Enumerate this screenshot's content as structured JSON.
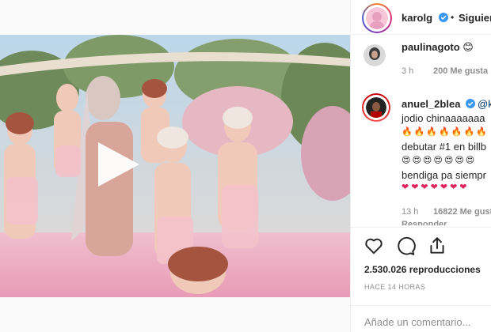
{
  "post": {
    "author": "karolg",
    "separator": "•",
    "follow_label": "Siguien"
  },
  "comments": [
    {
      "username": "paulinagoto",
      "lines": [
        "paulinagoto 😊"
      ],
      "time": "3 h",
      "likes": "200 Me gusta"
    },
    {
      "username": "anuel_2blea",
      "first_line_suffix": "@k",
      "lines": [
        "jodio chinaaaaaaa",
        "🔥🔥🔥🔥🔥🔥🔥",
        "debutar #1 en billb",
        "😍😍😍😍😍😍😍",
        "bendiga pa siempr"
      ],
      "hearts": "❤❤❤❤❤❤❤",
      "time": "13 h",
      "likes": "16822 Me gust",
      "reply_label": "Responder"
    }
  ],
  "stats": {
    "views": "2.530.026 reproducciones",
    "posted": "HACE 14 HORAS"
  },
  "add_comment": {
    "placeholder": "Añade un comentario..."
  },
  "icons": {
    "like": "heart-icon",
    "comment": "comment-icon",
    "share": "share-icon",
    "play": "play-icon",
    "verified": "verified-badge-icon"
  },
  "colors": {
    "verified": "#3897f0",
    "meta_gray": "#8e8e8e",
    "heart_red": "#e0245e"
  }
}
